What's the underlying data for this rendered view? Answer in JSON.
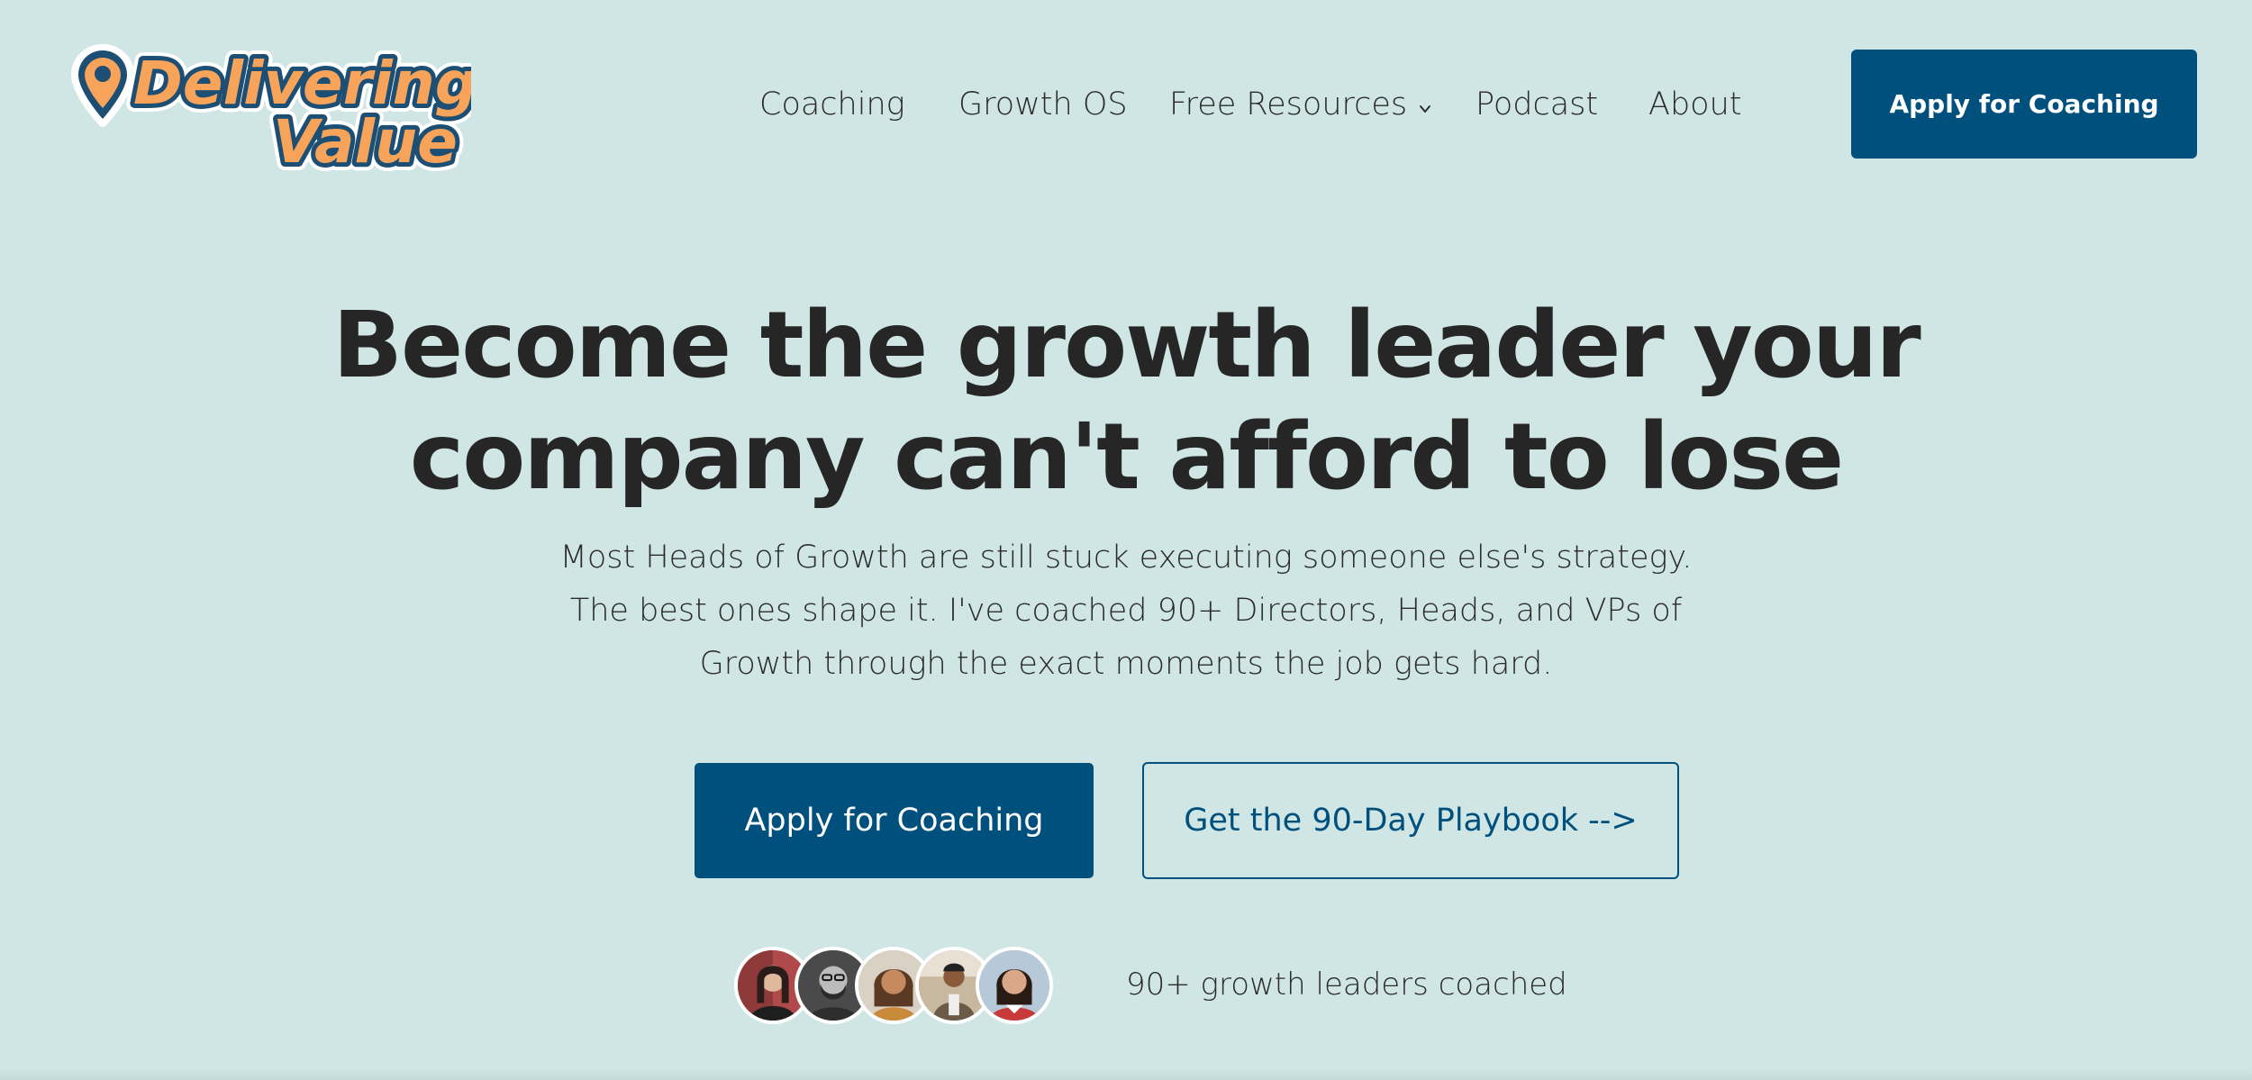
{
  "brand": {
    "logo_line1": "Delivering",
    "logo_line2": "Value",
    "colors": {
      "logo_fill": "#f7a45a",
      "logo_outline": "#1c4f73",
      "primary": "#00507d",
      "background": "#d0e6e4",
      "heading": "#262626"
    }
  },
  "nav": {
    "items": [
      {
        "label": "Coaching"
      },
      {
        "label": "Growth OS"
      },
      {
        "label": "Free Resources",
        "icon": "chevron-down-icon"
      },
      {
        "label": "Podcast"
      },
      {
        "label": "About"
      }
    ],
    "cta_label": "Apply for Coaching"
  },
  "hero": {
    "title_line1": "Become the growth leader your",
    "title_line2": "company can't afford to lose",
    "subtitle_line1": "Most Heads of Growth are still stuck executing someone else's strategy.",
    "subtitle_line2": "The best ones shape it. I've coached 90+ Directors, Heads, and VPs of",
    "subtitle_line3": "Growth through the exact moments the job gets hard.",
    "primary_cta": "Apply for Coaching",
    "secondary_cta": "Get the 90-Day Playbook -->"
  },
  "social_proof": {
    "avatar_count": 5,
    "text": "90+ growth leaders coached"
  }
}
